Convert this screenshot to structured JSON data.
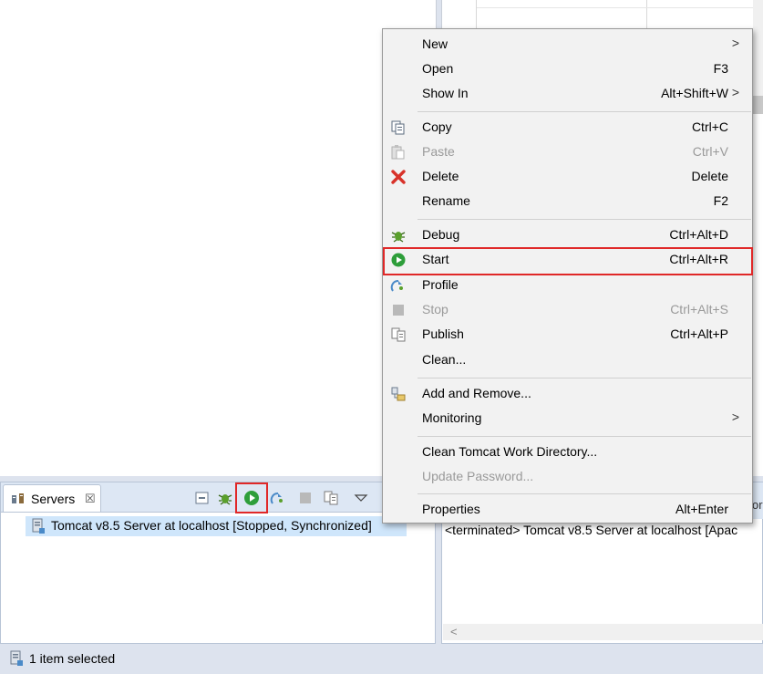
{
  "servers_view": {
    "tab_label": "Servers",
    "tab_close": "☒",
    "server_row": "Tomcat v8.5 Server at localhost  [Stopped, Synchronized]"
  },
  "console": {
    "line": "<terminated> Tomcat v8.5 Server at localhost [Apac",
    "fragment": "or",
    "scroll_left": "<"
  },
  "status_bar": {
    "text": "1 item selected"
  },
  "context_menu": {
    "items": [
      {
        "label": "New",
        "accel": "",
        "submenu": ">"
      },
      {
        "label": "Open",
        "accel": "F3",
        "submenu": ""
      },
      {
        "label": "Show In",
        "accel": "Alt+Shift+W",
        "submenu": ">"
      },
      {
        "label": "Copy",
        "accel": "Ctrl+C",
        "submenu": ""
      },
      {
        "label": "Paste",
        "accel": "Ctrl+V",
        "submenu": ""
      },
      {
        "label": "Delete",
        "accel": "Delete",
        "submenu": ""
      },
      {
        "label": "Rename",
        "accel": "F2",
        "submenu": ""
      },
      {
        "label": "Debug",
        "accel": "Ctrl+Alt+D",
        "submenu": ""
      },
      {
        "label": "Start",
        "accel": "Ctrl+Alt+R",
        "submenu": ""
      },
      {
        "label": "Profile",
        "accel": "",
        "submenu": ""
      },
      {
        "label": "Stop",
        "accel": "Ctrl+Alt+S",
        "submenu": ""
      },
      {
        "label": "Publish",
        "accel": "Ctrl+Alt+P",
        "submenu": ""
      },
      {
        "label": "Clean...",
        "accel": "",
        "submenu": ""
      },
      {
        "label": "Add and Remove...",
        "accel": "",
        "submenu": ""
      },
      {
        "label": "Monitoring",
        "accel": "",
        "submenu": ">"
      },
      {
        "label": "Clean Tomcat Work Directory...",
        "accel": "",
        "submenu": ""
      },
      {
        "label": "Update Password...",
        "accel": "",
        "submenu": ""
      },
      {
        "label": "Properties",
        "accel": "Alt+Enter",
        "submenu": ""
      }
    ]
  },
  "colors": {
    "highlight_border": "#e02828",
    "selection": "#cfe6fb",
    "start_green": "#2e9e3a"
  }
}
